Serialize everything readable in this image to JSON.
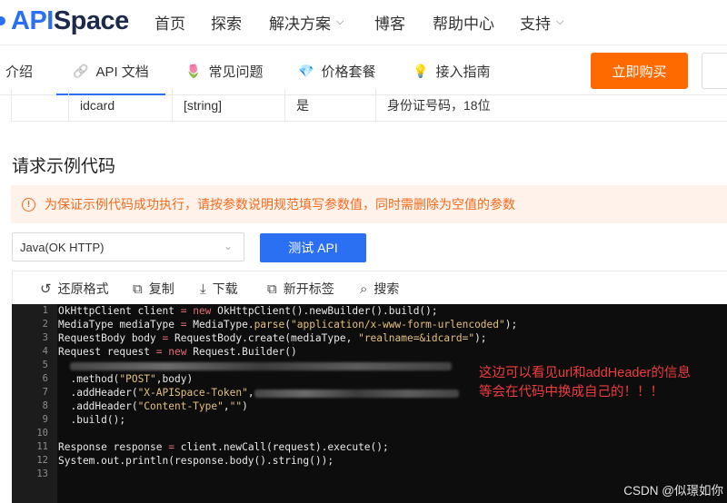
{
  "header": {
    "logo_api": "APISpace",
    "logo_prefix": "API",
    "logo_suffix": "Space",
    "nav": [
      {
        "label": "首页"
      },
      {
        "label": "探索"
      },
      {
        "label": "解决方案",
        "dropdown": true
      },
      {
        "label": "博客"
      },
      {
        "label": "帮助中心"
      },
      {
        "label": "支持",
        "dropdown": true
      }
    ],
    "chevron": "⌵"
  },
  "tabs": [
    {
      "label": "介绍",
      "icon": ""
    },
    {
      "label": "API 文档",
      "icon": "link-icon",
      "glyph": "🔗",
      "active": true
    },
    {
      "label": "常见问题",
      "icon": "flower-icon",
      "glyph": "🌷"
    },
    {
      "label": "价格套餐",
      "icon": "diamond-icon",
      "glyph": "💎"
    },
    {
      "label": "接入指南",
      "icon": "bulb-icon",
      "glyph": "💡"
    }
  ],
  "buy_button": "立即购买",
  "param_row": {
    "name": "idcard",
    "type": "[string]",
    "required": "是",
    "desc": "身份证号码，18位"
  },
  "section_title": "请求示例代码",
  "warning": {
    "icon": "!",
    "text": "为保证示例代码成功执行，请按参数说明规范填写参数值，同时需删除为空值的参数"
  },
  "language_select": {
    "value": "Java(OK HTTP)",
    "arrow": "⌄"
  },
  "test_button": "测试 API",
  "toolbar": [
    {
      "label": "还原格式",
      "icon": "restore-icon",
      "glyph": "↺"
    },
    {
      "label": "复制",
      "icon": "copy-icon",
      "glyph": "⧉"
    },
    {
      "label": "下载",
      "icon": "download-icon",
      "glyph": "⤓"
    },
    {
      "label": "新开标签",
      "icon": "external-link-icon",
      "glyph": "⧉"
    },
    {
      "label": "搜索",
      "icon": "search-icon",
      "glyph": "⌕"
    }
  ],
  "code": {
    "line_numbers": [
      "1",
      "2",
      "3",
      "4",
      "5",
      "6",
      "7",
      "8",
      "9",
      "10",
      "11",
      "12",
      "13"
    ],
    "l1a": "OkHttpClient client ",
    "l1op": "=",
    "l1kw": " new",
    "l1b": " OkHttpClient().newBuilder().build();",
    "l2a": "MediaType mediaType ",
    "l2op": "=",
    "l2b": " MediaType.",
    "l2c": "parse",
    "l2d": "(",
    "l2str": "\"application/x-www-form-urlencoded\"",
    "l2e": ");",
    "l3a": "RequestBody body ",
    "l3op": "=",
    "l3b": " RequestBody.create(mediaType, ",
    "l3str": "\"realname=&idcard=\"",
    "l3e": ");",
    "l4a": "Request request ",
    "l4op": "=",
    "l4kw": " new",
    "l4b": " Request.Builder()",
    "l6a": "  .method(",
    "l6str": "\"POST\"",
    "l6b": ",body)",
    "l7a": "  .addHeader(",
    "l7str": "\"X-APISpace-Token\"",
    "l7b": ",",
    "l8a": "  .addHeader(",
    "l8str": "\"Content-Type\"",
    "l8b": ",",
    "l8str2": "\"\"",
    "l8c": ")",
    "l9a": "  .build();",
    "l11a": "Response response ",
    "l11op": "=",
    "l11b": " client.newCall(request).execute();",
    "l12a": "System.out.println(response.body().string());"
  },
  "annotation": {
    "line1": "这边可以看见url和addHeader的信息",
    "line2": "等会在代码中换成自己的！！！"
  },
  "watermark": "CSDN @似璟如你"
}
